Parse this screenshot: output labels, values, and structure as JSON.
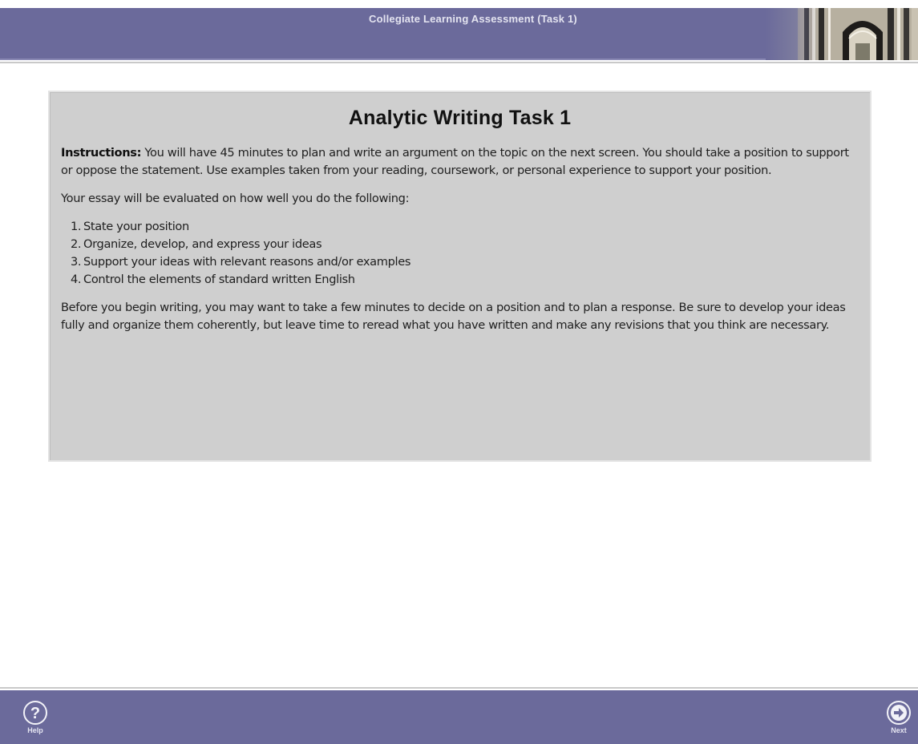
{
  "header": {
    "title": "Collegiate Learning Assessment  (Task 1)"
  },
  "task": {
    "title": "Analytic Writing Task 1",
    "instructions_label": "Instructions:",
    "instructions_text": " You will have 45 minutes to plan and write an argument on the topic on the next screen. You should take a position to support or oppose the statement.  Use examples taken from your reading, coursework, or personal experience to support your position.",
    "evaluation_intro": "Your essay will be evaluated on how well you do the following:",
    "criteria": [
      {
        "num": "1.",
        "text": "State your position"
      },
      {
        "num": "2.",
        "text": "Organize, develop, and express your ideas"
      },
      {
        "num": "3.",
        "text": "Support your ideas with relevant reasons and/or examples"
      },
      {
        "num": "4.",
        "text": "Control the elements of standard written English"
      }
    ],
    "closing_text": "Before you begin writing, you may want to take a few minutes to decide on a position and to plan a response. Be sure to develop your ideas fully and organize them coherently, but leave time to reread what you have written and make any revisions that you think are necessary."
  },
  "footer": {
    "help": {
      "label": "Help",
      "icon": "question-circle-icon"
    },
    "next": {
      "label": "Next",
      "icon": "arrow-right-circle-icon"
    }
  },
  "colors": {
    "bar": "#6b6a9b",
    "panel": "#cfcfcf",
    "text": "#202020"
  }
}
